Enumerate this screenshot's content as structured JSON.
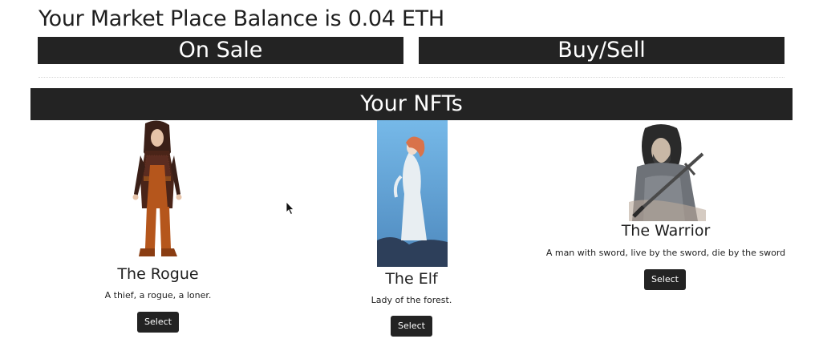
{
  "balance": {
    "text": "Your Market Place Balance is 0.04 ETH"
  },
  "tabs": {
    "on_sale": "On Sale",
    "buy_sell": "Buy/Sell"
  },
  "section": {
    "title": "Your NFTs"
  },
  "nfts": [
    {
      "name": "The Rogue",
      "description": "A thief, a rogue, a loner.",
      "button": "Select",
      "image_icon": "rogue-illustration"
    },
    {
      "name": "The Elf",
      "description": "Lady of the forest.",
      "button": "Select",
      "image_icon": "elf-illustration"
    },
    {
      "name": "The Warrior",
      "description": "A man with sword, live by the sword, die by the sword",
      "button": "Select",
      "image_icon": "warrior-illustration"
    }
  ],
  "colors": {
    "bar_background": "#232323",
    "bar_text": "#ffffff",
    "page_background": "#ffffff",
    "text": "#1e1e1e"
  }
}
